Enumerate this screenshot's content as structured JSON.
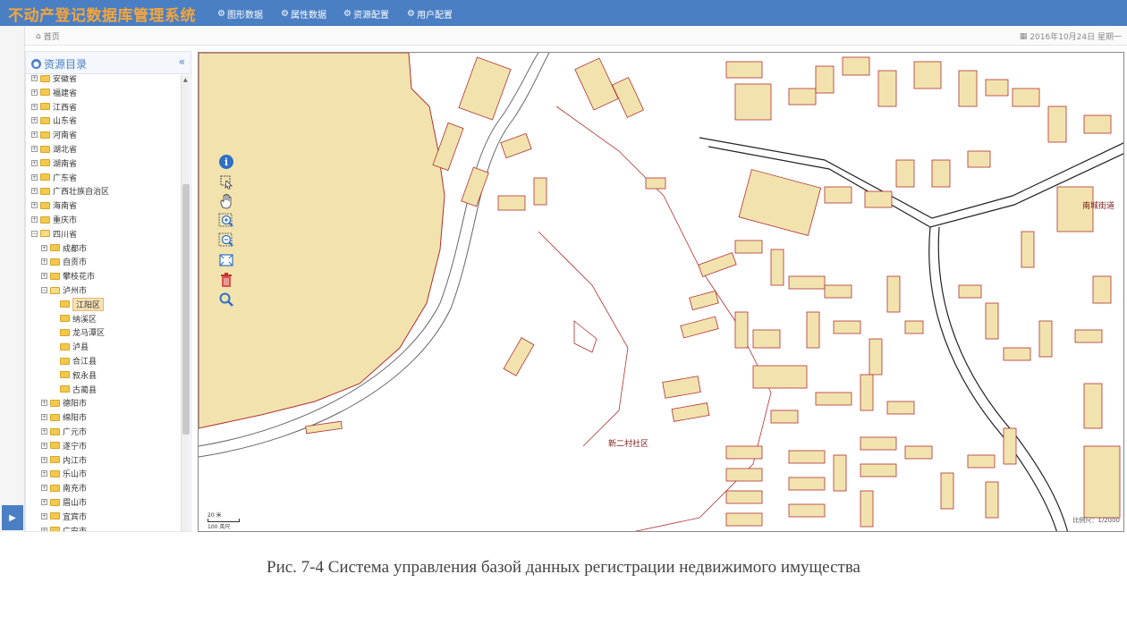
{
  "app": {
    "title": "不动产登记数据库管理系统"
  },
  "nav": [
    {
      "label": "图形数据",
      "icon": "gears-icon"
    },
    {
      "label": "属性数据",
      "icon": "gears-icon"
    },
    {
      "label": "资源配置",
      "icon": "gears-icon"
    },
    {
      "label": "用户配置",
      "icon": "gears-icon"
    }
  ],
  "breadcrumb": {
    "home": "首页"
  },
  "date": {
    "text": "2016年10月24日 星期一"
  },
  "panel": {
    "title": "资源目录",
    "collapse": "«"
  },
  "tree": [
    {
      "label": "安徽省",
      "level": 0,
      "state": "closed"
    },
    {
      "label": "福建省",
      "level": 0,
      "state": "closed"
    },
    {
      "label": "江西省",
      "level": 0,
      "state": "closed"
    },
    {
      "label": "山东省",
      "level": 0,
      "state": "closed"
    },
    {
      "label": "河南省",
      "level": 0,
      "state": "closed"
    },
    {
      "label": "湖北省",
      "level": 0,
      "state": "closed"
    },
    {
      "label": "湖南省",
      "level": 0,
      "state": "closed"
    },
    {
      "label": "广东省",
      "level": 0,
      "state": "closed"
    },
    {
      "label": "广西壮族自治区",
      "level": 0,
      "state": "closed"
    },
    {
      "label": "海南省",
      "level": 0,
      "state": "closed"
    },
    {
      "label": "重庆市",
      "level": 0,
      "state": "closed"
    },
    {
      "label": "四川省",
      "level": 0,
      "state": "open"
    },
    {
      "label": "成都市",
      "level": 1,
      "state": "closed"
    },
    {
      "label": "自贡市",
      "level": 1,
      "state": "closed"
    },
    {
      "label": "攀枝花市",
      "level": 1,
      "state": "closed"
    },
    {
      "label": "泸州市",
      "level": 1,
      "state": "open"
    },
    {
      "label": "江阳区",
      "level": 2,
      "state": "selected"
    },
    {
      "label": "纳溪区",
      "level": 2,
      "state": "leaf"
    },
    {
      "label": "龙马潭区",
      "level": 2,
      "state": "leaf"
    },
    {
      "label": "泸县",
      "level": 2,
      "state": "leaf"
    },
    {
      "label": "合江县",
      "level": 2,
      "state": "leaf"
    },
    {
      "label": "叙永县",
      "level": 2,
      "state": "leaf"
    },
    {
      "label": "古蔺县",
      "level": 2,
      "state": "leaf"
    },
    {
      "label": "德阳市",
      "level": 1,
      "state": "closed"
    },
    {
      "label": "绵阳市",
      "level": 1,
      "state": "closed"
    },
    {
      "label": "广元市",
      "level": 1,
      "state": "closed"
    },
    {
      "label": "遂宁市",
      "level": 1,
      "state": "closed"
    },
    {
      "label": "内江市",
      "level": 1,
      "state": "closed"
    },
    {
      "label": "乐山市",
      "level": 1,
      "state": "closed"
    },
    {
      "label": "南充市",
      "level": 1,
      "state": "closed"
    },
    {
      "label": "眉山市",
      "level": 1,
      "state": "closed"
    },
    {
      "label": "宜宾市",
      "level": 1,
      "state": "closed"
    },
    {
      "label": "广安市",
      "level": 1,
      "state": "closed"
    }
  ],
  "map": {
    "labels": {
      "community": "新二村社区",
      "street": "南城街道"
    },
    "scale": {
      "top": "20 米",
      "bottom": "100 英尺",
      "readout": "比例尺：1/2000"
    },
    "tools": [
      {
        "name": "info-icon"
      },
      {
        "name": "select-icon"
      },
      {
        "name": "pan-hand-icon"
      },
      {
        "name": "zoom-in-icon"
      },
      {
        "name": "zoom-out-icon"
      },
      {
        "name": "full-extent-icon"
      },
      {
        "name": "delete-icon"
      },
      {
        "name": "search-icon"
      }
    ],
    "colors": {
      "parcel": "#f2e3ae",
      "outline": "#b03030",
      "road": "#222222"
    }
  },
  "caption": "Рис. 7-4 Система управления базой данных регистрации недвижимого имущества"
}
